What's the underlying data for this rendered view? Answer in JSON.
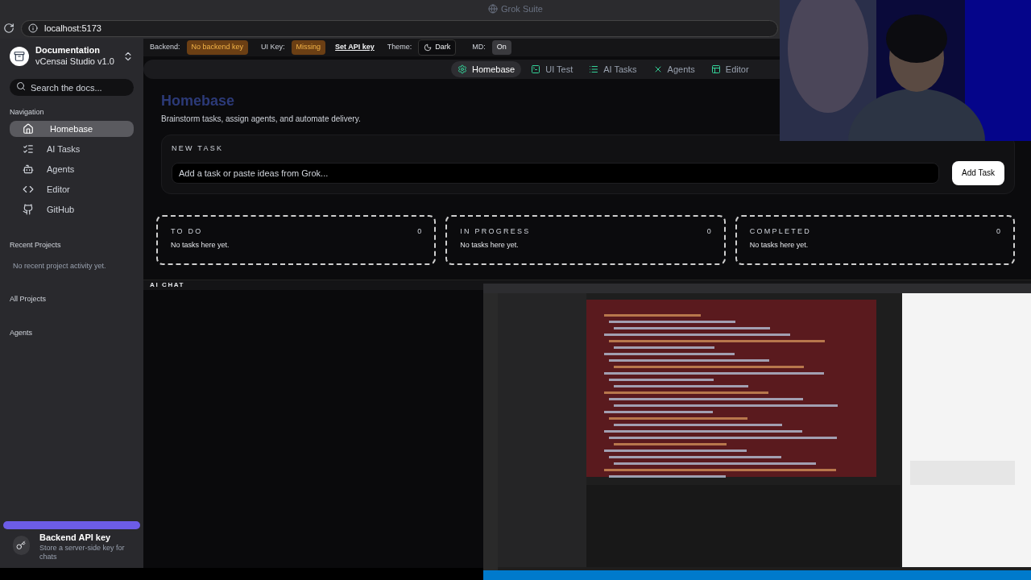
{
  "browser": {
    "title": "Grok Suite",
    "url": "localhost:5173"
  },
  "sidebar": {
    "workspace": {
      "name": "Documentation",
      "version": "vCensai Studio v1.0"
    },
    "search": {
      "placeholder": "Search the docs..."
    },
    "nav_heading": "Navigation",
    "nav_items": [
      {
        "label": "Homebase",
        "selected": true
      },
      {
        "label": "AI Tasks",
        "selected": false
      },
      {
        "label": "Agents",
        "selected": false
      },
      {
        "label": "Editor",
        "selected": false
      },
      {
        "label": "GitHub",
        "selected": false
      }
    ],
    "recent_heading": "Recent Projects",
    "recent_empty": "No recent project activity yet.",
    "all_projects": "All Projects",
    "agents_heading": "Agents",
    "api_card": {
      "title": "Backend API key",
      "description": "Store a server-side key for chats"
    }
  },
  "top_bar": {
    "backend": {
      "label": "Backend:",
      "value": "No backend key"
    },
    "ui_key": {
      "label": "UI Key:",
      "value": "Missing"
    },
    "set_key_link": "Set API key",
    "theme": {
      "label": "Theme:",
      "value": "Dark"
    },
    "md": {
      "label": "MD:",
      "value": "On",
      "on": true
    }
  },
  "tabs": [
    {
      "label": "Homebase",
      "selected": true
    },
    {
      "label": "UI Test",
      "selected": false
    },
    {
      "label": "AI Tasks",
      "selected": false
    },
    {
      "label": "Agents",
      "selected": false
    },
    {
      "label": "Editor",
      "selected": false
    }
  ],
  "page": {
    "title": "Homebase",
    "subtitle": "Brainstorm tasks, assign agents, and automate delivery.",
    "new_task": {
      "heading": "NEW TASK",
      "placeholder": "Add a task or paste ideas from Grok...",
      "button": "Add Task"
    },
    "columns": [
      {
        "title": "TO DO",
        "count": "0",
        "empty": "No tasks here yet."
      },
      {
        "title": "IN PROGRESS",
        "count": "0",
        "empty": "No tasks here yet."
      },
      {
        "title": "COMPLETED",
        "count": "0",
        "empty": "No tasks here yet."
      }
    ],
    "chat_heading": "AI CHAT"
  }
}
